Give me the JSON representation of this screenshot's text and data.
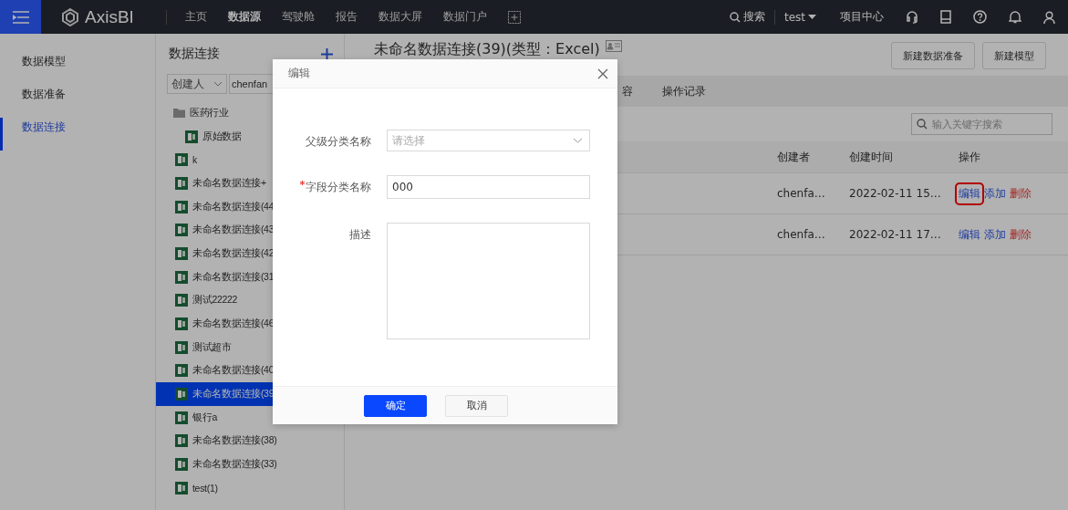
{
  "topbar": {
    "logo": "AxisBI",
    "nav": [
      {
        "label": "主页",
        "selected": false
      },
      {
        "label": "数据源",
        "selected": true
      },
      {
        "label": "驾驶舱",
        "selected": false
      },
      {
        "label": "报告",
        "selected": false
      },
      {
        "label": "数据大屏",
        "selected": false
      },
      {
        "label": "数据门户",
        "selected": false
      }
    ],
    "search": "搜索",
    "user": "test",
    "project": "项目中心"
  },
  "sidebar": {
    "items": [
      {
        "label": "数据模型",
        "selected": false
      },
      {
        "label": "数据准备",
        "selected": false
      },
      {
        "label": "数据连接",
        "selected": true
      }
    ]
  },
  "panel": {
    "title": "数据连接",
    "filter_field": "创建人",
    "filter_value": "chenfan",
    "tree": [
      {
        "kind": "folder",
        "label": "医药行业",
        "selected": false,
        "children": [
          {
            "kind": "file",
            "label": "原始数据",
            "selected": false
          }
        ]
      },
      {
        "kind": "file",
        "label": "k",
        "selected": false
      },
      {
        "kind": "file",
        "label": "未命名数据连接+",
        "selected": false
      },
      {
        "kind": "file",
        "label": "未命名数据连接(44",
        "selected": false
      },
      {
        "kind": "file",
        "label": "未命名数据连接(43",
        "selected": false
      },
      {
        "kind": "file",
        "label": "未命名数据连接(42",
        "selected": false
      },
      {
        "kind": "file",
        "label": "未命名数据连接(31",
        "selected": false
      },
      {
        "kind": "file",
        "label": "测试22222",
        "selected": false
      },
      {
        "kind": "file",
        "label": "未命名数据连接(46",
        "selected": false
      },
      {
        "kind": "file",
        "label": "测试超市",
        "selected": false
      },
      {
        "kind": "file",
        "label": "未命名数据连接(40",
        "selected": false
      },
      {
        "kind": "file",
        "label": "未命名数据连接(39",
        "selected": true
      },
      {
        "kind": "file",
        "label": "银行a",
        "selected": false
      },
      {
        "kind": "file",
        "label": "未命名数据连接(38)",
        "selected": false
      },
      {
        "kind": "file",
        "label": "未命名数据连接(33)",
        "selected": false
      },
      {
        "kind": "file",
        "label": "test(1)",
        "selected": false
      }
    ]
  },
  "main": {
    "title": "未命名数据连接(39)(类型：Excel)",
    "buttons": [
      "新建数据准备",
      "新建模型"
    ],
    "tabs": [
      "容",
      "操作记录"
    ],
    "search_placeholder": "输入关键字搜索",
    "table": {
      "columns": [
        "创建者",
        "创建时间",
        "操作"
      ],
      "rows": [
        {
          "creator": "chenfa…",
          "time": "2022-02-11 15…",
          "actions": [
            {
              "kind": "edit",
              "label": "编辑",
              "highlighted": true
            },
            {
              "kind": "add",
              "label": "添加",
              "highlighted": false
            },
            {
              "kind": "delete",
              "label": "删除",
              "highlighted": false
            }
          ]
        },
        {
          "creator": "chenfa…",
          "time": "2022-02-11 17…",
          "actions": [
            {
              "kind": "edit",
              "label": "编辑",
              "highlighted": false
            },
            {
              "kind": "add",
              "label": "添加",
              "highlighted": false
            },
            {
              "kind": "delete",
              "label": "删除",
              "highlighted": false
            }
          ]
        }
      ]
    }
  },
  "dialog": {
    "title": "编辑",
    "fields": [
      {
        "kind": "select",
        "label": "父级分类名称",
        "required": false,
        "placeholder": "请选择"
      },
      {
        "kind": "text",
        "label": "字段分类名称",
        "required": true,
        "value": "000"
      },
      {
        "kind": "textarea",
        "label": "描述",
        "required": false
      }
    ],
    "buttons": [
      {
        "label": "确定",
        "primary": true
      },
      {
        "label": "取消",
        "primary": false
      }
    ]
  }
}
